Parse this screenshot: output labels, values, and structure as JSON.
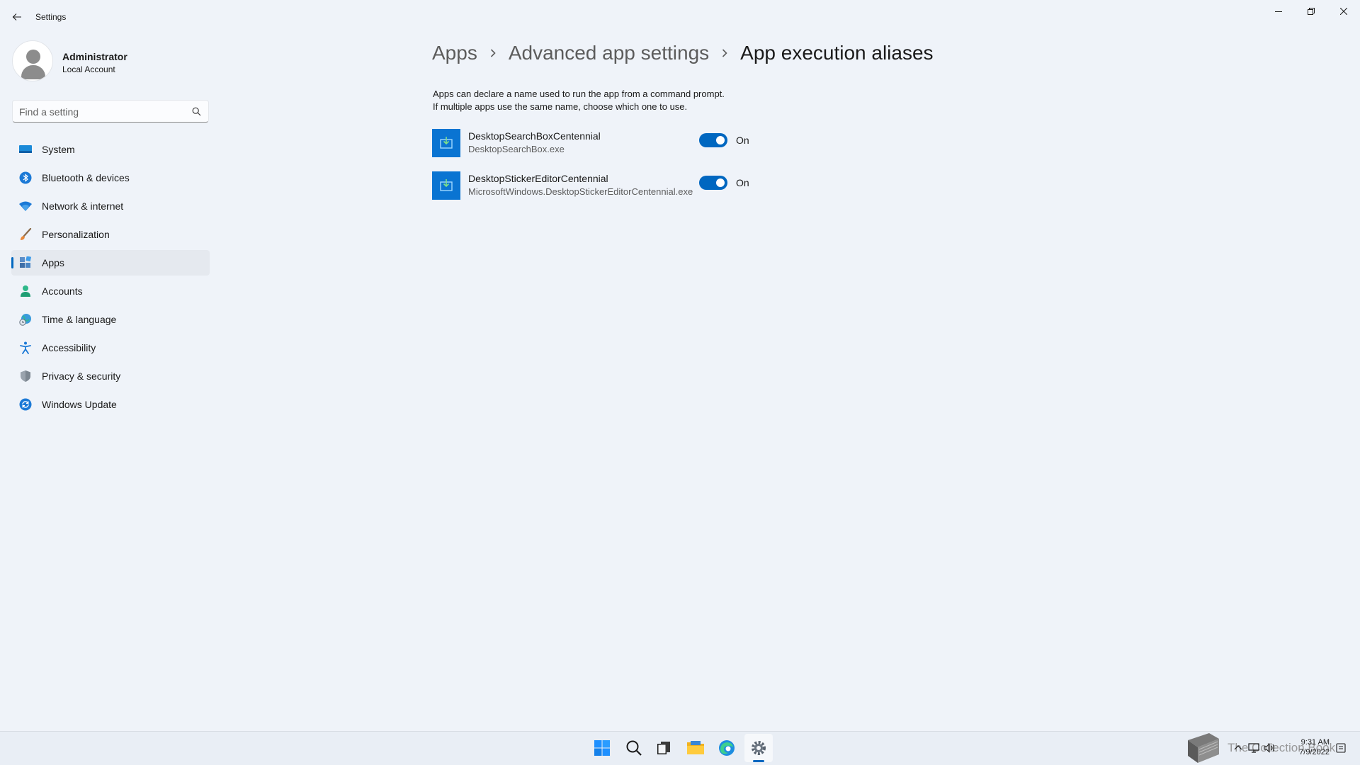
{
  "window": {
    "title": "Settings"
  },
  "profile": {
    "name": "Administrator",
    "account_type": "Local Account"
  },
  "search": {
    "placeholder": "Find a setting",
    "value": ""
  },
  "sidebar": {
    "items": [
      {
        "label": "System",
        "icon": "system-monitor-icon",
        "active": false
      },
      {
        "label": "Bluetooth & devices",
        "icon": "bluetooth-icon",
        "active": false
      },
      {
        "label": "Network & internet",
        "icon": "wifi-icon",
        "active": false
      },
      {
        "label": "Personalization",
        "icon": "brush-icon",
        "active": false
      },
      {
        "label": "Apps",
        "icon": "apps-icon",
        "active": true
      },
      {
        "label": "Accounts",
        "icon": "person-icon",
        "active": false
      },
      {
        "label": "Time & language",
        "icon": "globe-clock-icon",
        "active": false
      },
      {
        "label": "Accessibility",
        "icon": "accessibility-icon",
        "active": false
      },
      {
        "label": "Privacy & security",
        "icon": "shield-icon",
        "active": false
      },
      {
        "label": "Windows Update",
        "icon": "update-icon",
        "active": false
      }
    ]
  },
  "breadcrumb": {
    "items": [
      "Apps",
      "Advanced app settings",
      "App execution aliases"
    ]
  },
  "description": {
    "line1": "Apps can declare a name used to run the app from a command prompt.",
    "line2": "If multiple apps use the same name, choose which one to use."
  },
  "aliases": [
    {
      "name": "DesktopSearchBoxCentennial",
      "executable": "DesktopSearchBox.exe",
      "state_label": "On",
      "enabled": true
    },
    {
      "name": "DesktopStickerEditorCentennial",
      "executable": "MicrosoftWindows.DesktopStickerEditorCentennial.exe",
      "state_label": "On",
      "enabled": true
    }
  ],
  "taskbar": {
    "apps": [
      "windows-start-icon",
      "search-icon",
      "task-view-icon",
      "file-explorer-icon",
      "edge-icon",
      "settings-gear-icon"
    ],
    "watermark": "The Collection Book",
    "time": "9:31 AM",
    "date": "7/9/2022"
  },
  "colors": {
    "accent": "#0067c0",
    "tile": "#0a74d2",
    "background": "#eff3f9"
  }
}
